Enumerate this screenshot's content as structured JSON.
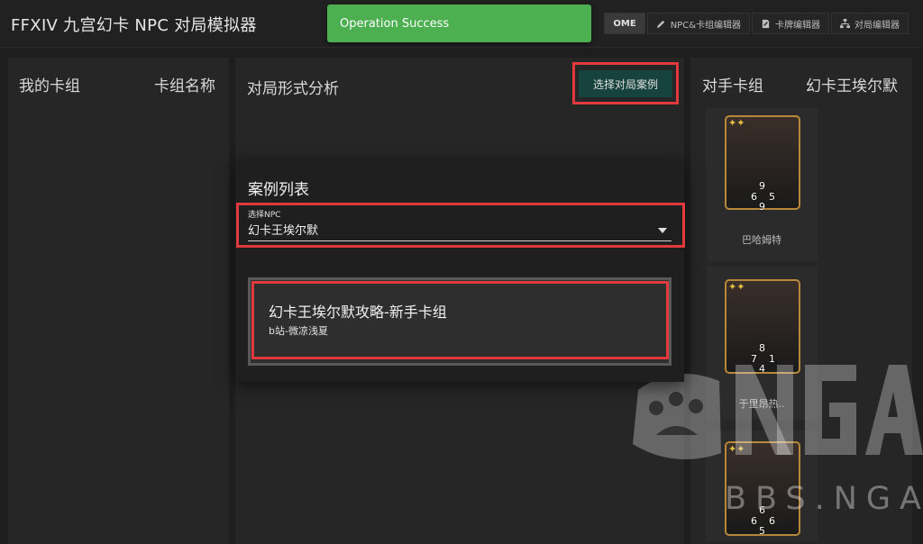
{
  "app": {
    "title": "FFXIV 九宫幻卡 NPC 对局模拟器",
    "nav": [
      {
        "label": "OME"
      },
      {
        "label": "NPC&卡组编辑器"
      },
      {
        "label": "卡牌编辑器"
      },
      {
        "label": "对局编辑器"
      }
    ]
  },
  "toast": {
    "message": "Operation Success"
  },
  "left_panel": {
    "heading": "我的卡组",
    "deck_name": "卡组名称"
  },
  "mid_panel": {
    "heading": "对局形式分析",
    "select_case_button": "选择对局案例"
  },
  "right_panel": {
    "heading": "对手卡组",
    "npc_name": "幻卡王埃尔默",
    "cards": [
      {
        "name": "巴哈姆特",
        "top": "9",
        "left": "6",
        "right": "5",
        "bottom": "9"
      },
      {
        "name": "于里昂热..",
        "top": "8",
        "left": "7",
        "right": "1",
        "bottom": "4"
      },
      {
        "name": "",
        "top": "6",
        "left": "6",
        "right": "6",
        "bottom": "5"
      }
    ]
  },
  "modal": {
    "title": "案例列表",
    "select_npc_label": "选择NPC",
    "select_npc_value": "幻卡王埃尔默",
    "case": {
      "title": "幻卡王埃尔默攻略-新手卡组",
      "author": "b站-微凉浅夏"
    }
  },
  "watermark": {
    "logo": "NGA",
    "site": "BBS.NGA.CN"
  },
  "colors": {
    "accent_button": "#16433d",
    "toast": "#4caf50",
    "highlight": "#e0393e",
    "card_frame": "#b8883a"
  }
}
